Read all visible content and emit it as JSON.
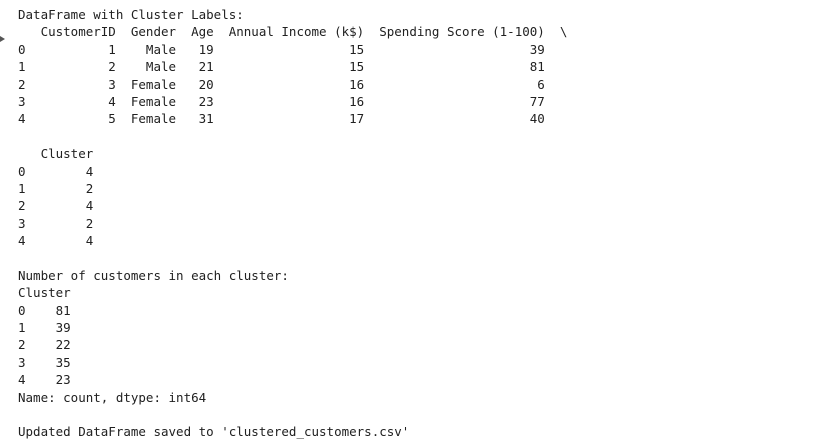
{
  "output": {
    "lines_block1": [
      "DataFrame with Cluster Labels:",
      "   CustomerID  Gender  Age  Annual Income (k$)  Spending Score (1-100)  \\",
      "0           1    Male   19                  15                      39   ",
      "1           2    Male   21                  15                      81   ",
      "2           3  Female   20                  16                       6   ",
      "3           4  Female   23                  16                      77   ",
      "4           5  Female   31                  17                      40   "
    ],
    "lines_block2": [
      "   Cluster  ",
      "0        4  ",
      "1        2  ",
      "2        4  ",
      "3        2  ",
      "4        4  "
    ],
    "lines_block3": [
      "Number of customers in each cluster:",
      "Cluster",
      "0    81",
      "1    39",
      "2    22",
      "3    35",
      "4    23",
      "Name: count, dtype: int64"
    ],
    "lines_block4": [
      "Updated DataFrame saved to 'clustered_customers.csv'"
    ]
  }
}
